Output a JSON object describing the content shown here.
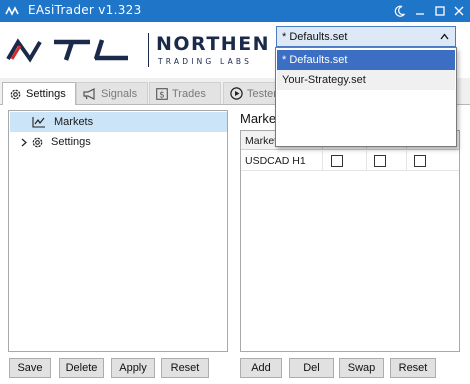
{
  "window": {
    "title": "EAsiTrader v1.323",
    "accent": "#1f75c8"
  },
  "brand": {
    "logo_text": "NTL",
    "name": "NORTHEN",
    "subtitle": "TRADING LABS"
  },
  "preset": {
    "selected": "* Defaults.set",
    "options": [
      "* Defaults.set",
      "Your-Strategy.set"
    ],
    "highlighted_index": 0
  },
  "tabs": [
    {
      "label": "Settings",
      "icon": "gear-icon",
      "active": true
    },
    {
      "label": "Signals",
      "icon": "megaphone-icon",
      "active": false
    },
    {
      "label": "Trades",
      "icon": "dollar-icon",
      "active": false
    },
    {
      "label": "Tester",
      "icon": "play-icon",
      "active": false
    }
  ],
  "tree": {
    "items": [
      {
        "label": "Markets",
        "icon": "chart-line-icon",
        "selected": true,
        "expandable": false
      },
      {
        "label": "Settings",
        "icon": "gear-icon",
        "selected": false,
        "expandable": true
      }
    ]
  },
  "markets": {
    "title": "Markets",
    "column_header": "Market",
    "rows": [
      {
        "symbol": "USDCAD H1",
        "checks": [
          false,
          false,
          false
        ]
      }
    ]
  },
  "left_buttons": [
    "Save",
    "Delete",
    "Apply",
    "Reset"
  ],
  "right_buttons": [
    "Add",
    "Del",
    "Swap",
    "Reset"
  ]
}
